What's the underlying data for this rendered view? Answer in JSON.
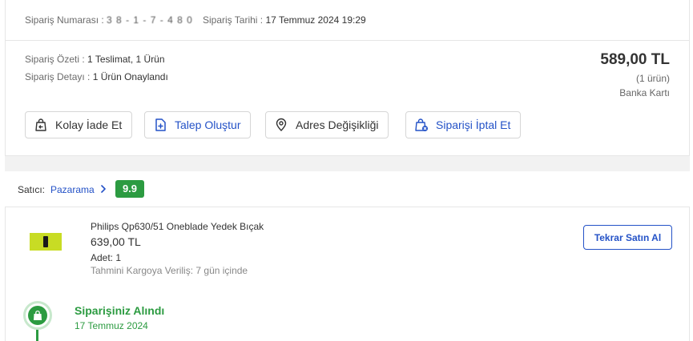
{
  "header": {
    "order_no_label": "Sipariş Numarası :",
    "order_no_value": "3 8 - 1 - 7 - 4 8 0",
    "order_date_label": "Sipariş Tarihi :",
    "order_date_value": "17 Temmuz 2024 19:29"
  },
  "summary": {
    "overview_label": "Sipariş Özeti :",
    "overview_value": "1 Teslimat, 1 Ürün",
    "detail_label": "Sipariş Detayı :",
    "detail_value": "1 Ürün Onaylandı",
    "total_price": "589,00 TL",
    "item_count": "(1 ürün)",
    "payment_method": "Banka Kartı"
  },
  "actions": {
    "easy_return": "Kolay İade Et",
    "create_request": "Talep Oluştur",
    "address_change": "Adres Değişikliği",
    "cancel_order": "Siparişi İptal Et"
  },
  "seller": {
    "label": "Satıcı:",
    "name": "Pazarama",
    "score": "9.9"
  },
  "product": {
    "name": "Philips Qp630/51 Oneblade Yedek Bıçak",
    "price": "639,00 TL",
    "quantity": "Adet: 1",
    "shipping_estimate": "Tahmini Kargoya Veriliş: 7 gün içinde",
    "rebuy_label": "Tekrar Satın Al"
  },
  "status": {
    "title": "Siparişiniz Alındı",
    "date": "17 Temmuz 2024"
  },
  "colors": {
    "accent_blue": "#2452c7",
    "success_green": "#2c9b41",
    "product_image_yellow": "#c8dc24"
  }
}
